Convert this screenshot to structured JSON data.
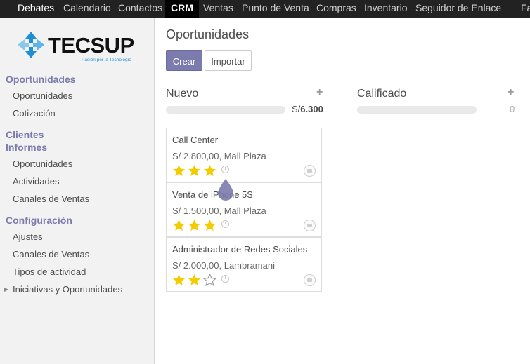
{
  "topnav": {
    "items": [
      "Debates",
      "Calendario",
      "Contactos",
      "CRM",
      "Ventas",
      "Punto de Venta",
      "Compras",
      "Inventario",
      "Seguidor de Enlace",
      "Factu"
    ]
  },
  "logo": {
    "name": "TECSUP",
    "tagline": "Pasión por la Tecnología"
  },
  "sidebar": {
    "section1": "Oportunidades",
    "s1_items": [
      "Oportunidades",
      "Cotización"
    ],
    "section2": "Clientes",
    "section3": "Informes",
    "s3_items": [
      "Oportunidades",
      "Actividades",
      "Canales de Ventas"
    ],
    "section4": "Configuración",
    "s4_items": [
      "Ajustes",
      "Canales de Ventas",
      "Tipos de actividad",
      "Iniciativas y Oportunidades"
    ]
  },
  "main": {
    "title": "Oportunidades",
    "create_label": "Crear",
    "import_label": "Importar",
    "columns": [
      {
        "title": "Nuevo",
        "plus": "+",
        "sum_prefix": "S/",
        "sum": "6.300"
      },
      {
        "title": "Calificado",
        "plus": "+",
        "sum": "0"
      }
    ],
    "cards": [
      {
        "name": "Call Center",
        "amount": "S/ 2.800,00, Mall Plaza",
        "rating": 3
      },
      {
        "name": "Venta de iPhone 5S",
        "amount": "S/ 1.500,00, Mall Plaza",
        "rating": 3
      },
      {
        "name": "Administrador de Redes Sociales",
        "amount": "S/ 2.000,00, Lambramani",
        "rating": 2
      }
    ]
  },
  "colors": {
    "accent": "#7c7bad",
    "star": "#f3cc00",
    "topbar": "#222222"
  }
}
